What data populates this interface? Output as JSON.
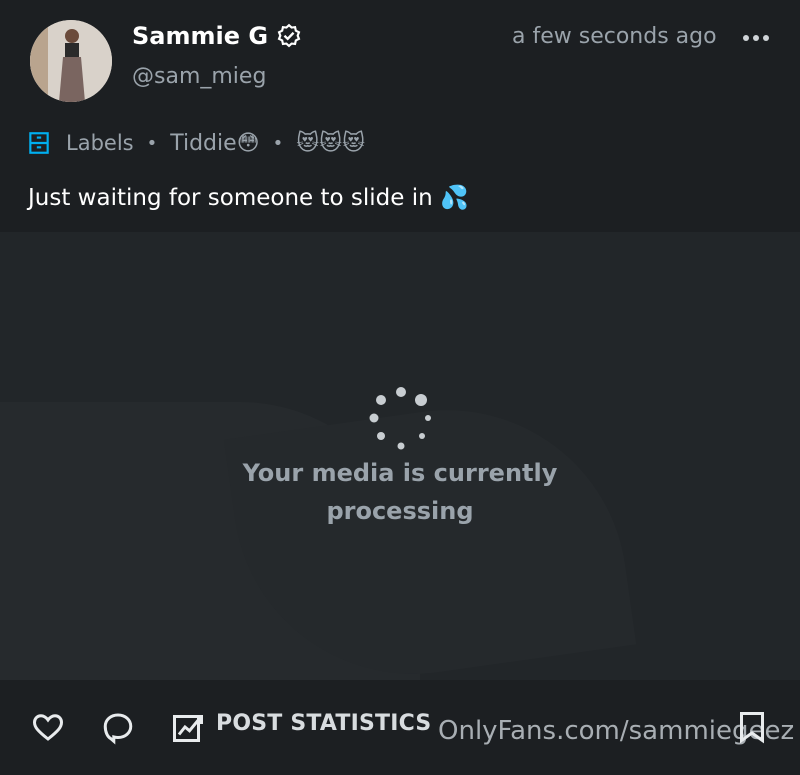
{
  "post": {
    "author_name": "Sammie G",
    "handle": "@sam_mieg",
    "timestamp": "a few seconds ago",
    "labels": {
      "title": "Labels",
      "items": [
        "Tiddie😳",
        "😻😻😻"
      ],
      "separator": "•"
    },
    "text": "Just waiting for someone to slide in 💦",
    "media": {
      "status_text": "Your media is currently processing"
    }
  },
  "footer": {
    "stats_label": "POST STATISTICS",
    "watermark": "OnlyFans.com/sammiegeez"
  },
  "colors": {
    "accent": "#00aff0",
    "background": "#1c1f22",
    "muted_text": "#9aa3ab"
  },
  "icons": [
    "verified-icon",
    "more-options-icon",
    "labels-icon",
    "spinner-icon",
    "like-icon",
    "comment-icon",
    "statistics-icon",
    "bookmark-icon"
  ]
}
